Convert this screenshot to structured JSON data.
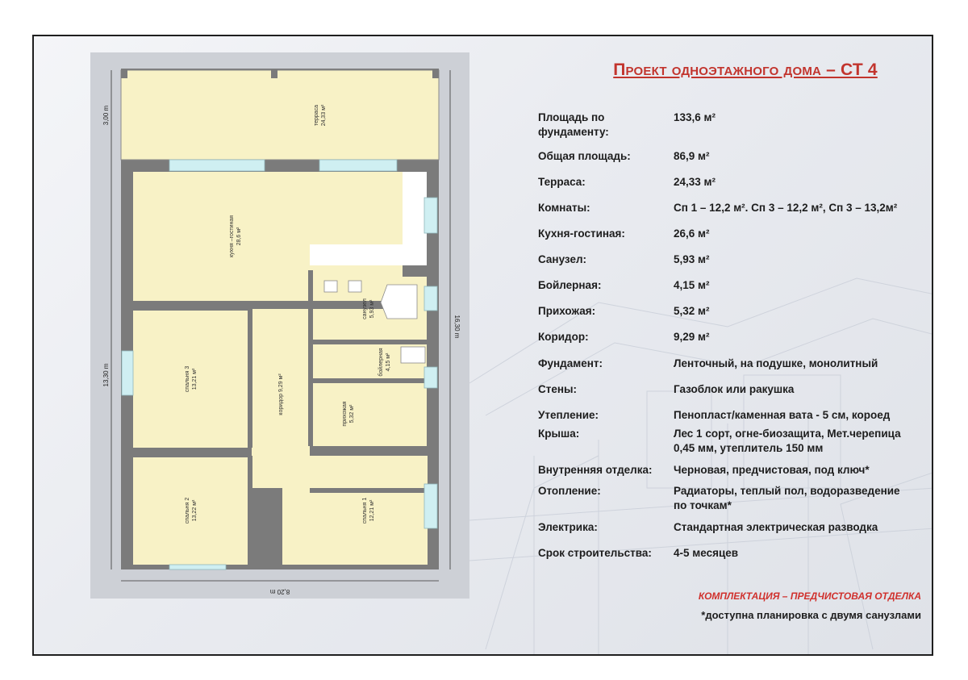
{
  "title": "Проект одноэтажного дома – СТ 4",
  "specs": [
    {
      "label": "Площадь по фундаменту:",
      "value": "133,6 м²"
    },
    {
      "label": "Общая площадь:",
      "value": "86,9 м²"
    },
    {
      "label": "Терраса:",
      "value": "24,33 м²"
    },
    {
      "label": "Комнаты:",
      "value": "Сп 1 – 12,2 м². Сп 3 – 12,2 м², Сп 3 – 13,2м²"
    },
    {
      "label": "Кухня-гостиная:",
      "value": "26,6 м²"
    },
    {
      "label": "Санузел:",
      "value": "5,93 м²"
    },
    {
      "label": "Бойлерная:",
      "value": "4,15 м²"
    },
    {
      "label": "Прихожая:",
      "value": "5,32 м²"
    },
    {
      "label": "Коридор:",
      "value": "9,29 м²"
    },
    {
      "label": "Фундамент:",
      "value": "Ленточный, на подушке, монолитный"
    },
    {
      "label": "Стены:",
      "value": "Газоблок или ракушка"
    },
    {
      "label": "Утепление:",
      "value": "Пенопласт/каменная вата -  5 см, короед"
    },
    {
      "label": "Крыша:",
      "value": "Лес 1 сорт, огне-биозащита,  Мет.черепица 0,45 мм, утеплитель 150 мм"
    },
    {
      "label": "Внутренняя отделка:",
      "value": "Черновая, предчистовая, под ключ*"
    },
    {
      "label": "Отопление:",
      "value": "Радиаторы, теплый пол, водоразведение по точкам*"
    },
    {
      "label": "Электрика:",
      "value": "Стандартная электрическая разводка"
    },
    {
      "label": "Срок строительства:",
      "value": "4-5 месяцев"
    }
  ],
  "notes": {
    "package": "КОМПЛЕКТАЦИЯ – ПРЕДЧИСТОВАЯ ОТДЕЛКА",
    "footnote": "*доступна планировка с двумя санузлами"
  },
  "plan": {
    "rooms": {
      "terrace": {
        "name": "терраса",
        "area": "24,33 м²"
      },
      "kitchen": {
        "name": "кухня –гостиная",
        "area": "28,6 м²"
      },
      "bath": {
        "name": "санузел",
        "area": "5,93 м²"
      },
      "boiler": {
        "name": "бойлерная",
        "area": "4,15 м²"
      },
      "hall": {
        "name": "прихожая",
        "area": "5,32 м²"
      },
      "corridor": {
        "name": "коридор 9,29 м²"
      },
      "bed3": {
        "name": "спальня 3",
        "area": "13,21 м²"
      },
      "bed2": {
        "name": "спальня 2",
        "area": "13,22 м²"
      },
      "bed1": {
        "name": "спальня 1",
        "area": "12,21 м²"
      }
    },
    "dims": {
      "top": "3,00 m",
      "left": "13,30 m",
      "right": "16,30 m",
      "bottom": "8,20 m"
    }
  }
}
